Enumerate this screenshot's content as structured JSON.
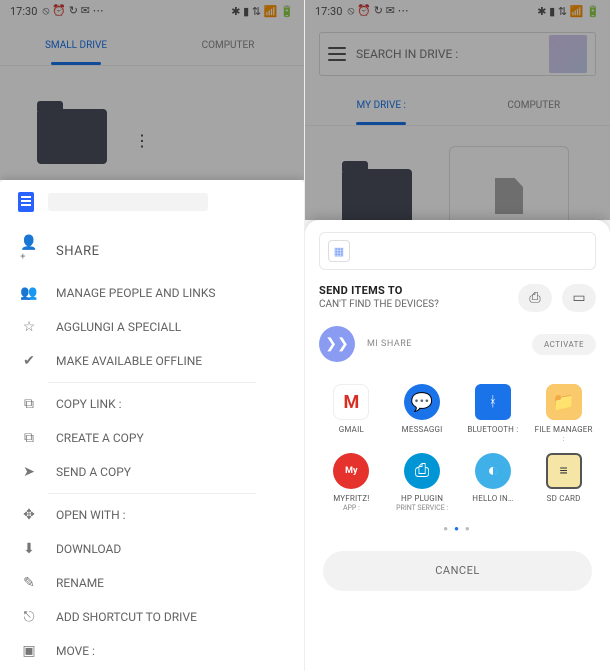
{
  "status": {
    "time": "17:30"
  },
  "left": {
    "tabs": {
      "drive": "SMALL DRIVE",
      "computer": "COMPUTER"
    },
    "menu": {
      "share": "SHARE",
      "manage": "MANAGE PEOPLE AND LINKS",
      "special": "AGGLUNGI A SPECIALL",
      "offline": "MAKE AVAILABLE OFFLINE",
      "copylink": "COPY LINK :",
      "createcopy": "CREATE A COPY",
      "sendcopy": "SEND A COPY",
      "openwith": "OPEN WITH :",
      "download": "DOWNLOAD",
      "rename": "RENAME",
      "shortcut": "ADD SHORTCUT TO DRIVE",
      "move": "MOVE :"
    }
  },
  "right": {
    "search_placeholder": "SEARCH IN DRIVE :",
    "tabs": {
      "mydrive": "MY DRIVE :",
      "computer": "COMPUTER"
    },
    "send_title": "SEND ITEMS TO",
    "send_sub": "CAN'T FIND THE DEVICES?",
    "mishare": "MI SHARE",
    "activate": "ACTIVATE",
    "apps": [
      {
        "name": "GMAIL",
        "sub": ""
      },
      {
        "name": "MESSAGGI",
        "sub": ""
      },
      {
        "name": "BLUETOOTH :",
        "sub": ""
      },
      {
        "name": "FILE MANAGER",
        "sub": ":"
      },
      {
        "name": "MYFRITZ!",
        "sub": "APP :"
      },
      {
        "name": "HP PLUGIN",
        "sub": "PRINT SERVICE :"
      },
      {
        "name": "HELLO IN…",
        "sub": ""
      },
      {
        "name": "SD CARD",
        "sub": ""
      }
    ],
    "cancel": "CANCEL"
  }
}
